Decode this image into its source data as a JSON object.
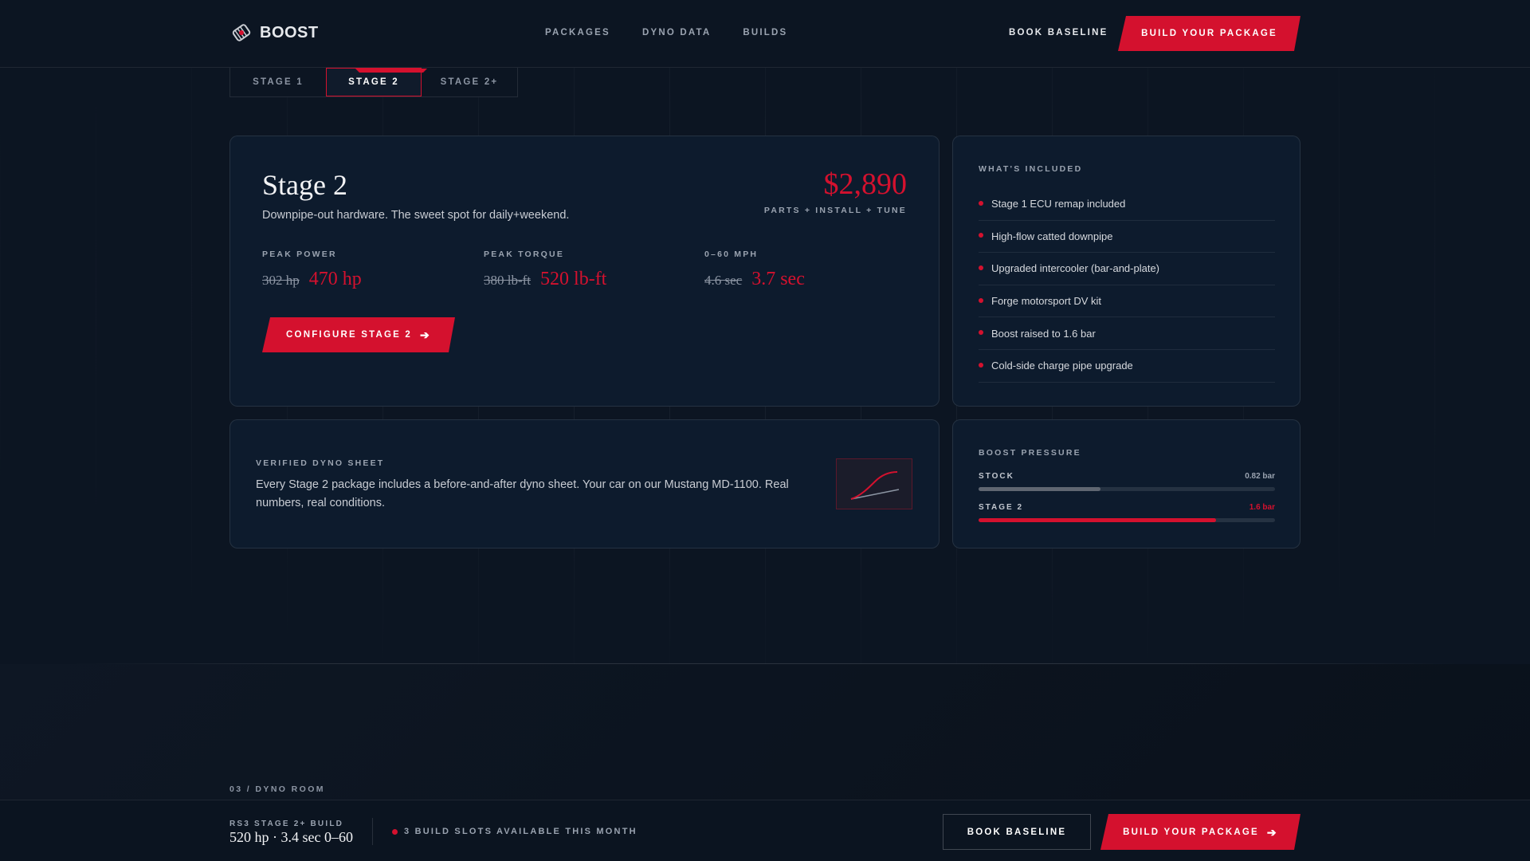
{
  "brand": {
    "name": "BOOST",
    "logo_icon": "turbo-icon"
  },
  "nav": {
    "items": [
      "PACKAGES",
      "DYNO DATA",
      "BUILDS"
    ]
  },
  "header": {
    "book_label": "BOOK BASELINE",
    "build_label": "BUILD YOUR PACKAGE"
  },
  "colors": {
    "accent": "#d4112e",
    "background": "#0c1522",
    "card": "#0d1b2d"
  },
  "tabs": [
    {
      "label": "STAGE 1",
      "active": false
    },
    {
      "label": "STAGE 2",
      "active": true
    },
    {
      "label": "STAGE 2+",
      "active": false
    }
  ],
  "stage": {
    "title": "Stage 2",
    "description": "Downpipe-out hardware. The sweet spot for daily+weekend.",
    "price": "$2,890",
    "price_note": "PARTS + INSTALL + TUNE",
    "stats": [
      {
        "label": "PEAK POWER",
        "old": "302 hp",
        "new": "470 hp"
      },
      {
        "label": "PEAK TORQUE",
        "old": "380 lb-ft",
        "new": "520 lb-ft"
      },
      {
        "label": "0–60 MPH",
        "old": "4.6 sec",
        "new": "3.7 sec"
      }
    ],
    "configure_label": "CONFIGURE STAGE 2"
  },
  "included": {
    "title": "WHAT'S INCLUDED",
    "items": [
      "Stage 1 ECU remap included",
      "High-flow catted downpipe",
      "Upgraded intercooler (bar-and-plate)",
      "Forge motorsport DV kit",
      "Boost raised to 1.6 bar",
      "Cold-side charge pipe upgrade"
    ]
  },
  "dyno": {
    "title": "VERIFIED DYNO SHEET",
    "text": "Every Stage 2 package includes a before-and-after dyno sheet. Your car on our Mustang MD-1100. Real numbers, real conditions.",
    "thumb_icon": "dyno-curve-icon"
  },
  "boost": {
    "title": "BOOST PRESSURE",
    "rows": [
      {
        "label": "STOCK",
        "value": "0.82 bar",
        "fill_fraction": 0.41
      },
      {
        "label": "STAGE 2",
        "value": "1.6 bar",
        "fill_fraction": 0.8
      }
    ]
  },
  "section": {
    "label": "03 / DYNO ROOM"
  },
  "footer": {
    "build_label": "RS3 STAGE 2+ BUILD",
    "build_stats": "520 hp · 3.4 sec 0–60",
    "slots_text": "3 BUILD SLOTS AVAILABLE THIS MONTH",
    "book_label": "BOOK BASELINE",
    "build_button_label": "BUILD YOUR PACKAGE"
  }
}
